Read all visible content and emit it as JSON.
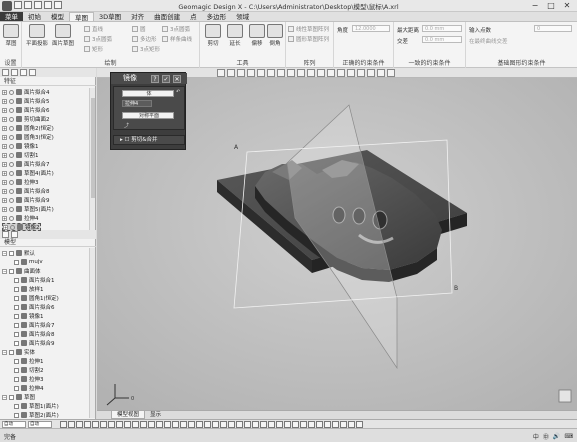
{
  "window": {
    "title": "Geomagic Design X - C:\\Users\\Administrator\\Desktop\\模型\\鼠标\\A.xrl",
    "minimize": "−",
    "maximize": "□",
    "close": "✕"
  },
  "menu": {
    "tabs": [
      {
        "label": "菜单"
      },
      {
        "label": "初始"
      },
      {
        "label": "模型"
      },
      {
        "label": "草图"
      },
      {
        "label": "3D草图"
      },
      {
        "label": "对齐"
      },
      {
        "label": "曲面创建"
      },
      {
        "label": "点"
      },
      {
        "label": "多边形"
      },
      {
        "label": "领域"
      }
    ]
  },
  "ribbon": {
    "groups": [
      {
        "label": "设置",
        "big": "草图"
      },
      {
        "label": "绘制"
      },
      {
        "label": "工具"
      },
      {
        "label": "阵列"
      },
      {
        "label": "正确的约束条件"
      },
      {
        "label": "一致的约束条件"
      },
      {
        "label": "基础图形约束条件"
      }
    ],
    "draw_items": [
      "直线",
      "3点圆弧",
      "矩形",
      "圆",
      "多边形",
      "3点圆弧",
      "3点矩形",
      "样条曲线"
    ],
    "draw_big": [
      "平面投影",
      "面片草图"
    ],
    "tool_items": [
      "剪切",
      "延长",
      "偏移",
      "倒角"
    ],
    "pattern_items": [
      "线性草图阵列",
      "圆形草图阵列"
    ],
    "constraints": {
      "angle_label": "角度",
      "angle_value": "12.0000",
      "max_offset_label": "最大距离",
      "max_offset_value": "0.0 mm",
      "cross_label": "交差",
      "cross_value": "0.0 mm",
      "input_label": "输入点数",
      "input_value": "0",
      "check_label": "在最终曲线交差"
    }
  },
  "left_panel": {
    "feature_title": "特征",
    "features": [
      {
        "label": "面片拟合4",
        "selected": false
      },
      {
        "label": "面片拟合5",
        "selected": false
      },
      {
        "label": "面片拟合6",
        "selected": false
      },
      {
        "label": "剪切曲面2",
        "selected": false
      },
      {
        "label": "圆角2(恒定)",
        "selected": false
      },
      {
        "label": "圆角3(恒定)",
        "selected": false
      },
      {
        "label": "镜像1",
        "selected": false
      },
      {
        "label": "切割1",
        "selected": false
      },
      {
        "label": "面片拟合7",
        "selected": false
      },
      {
        "label": "草图4(面片)",
        "selected": false
      },
      {
        "label": "拉伸3",
        "selected": false
      },
      {
        "label": "面片拟合8",
        "selected": false
      },
      {
        "label": "面片拟合9",
        "selected": false
      },
      {
        "label": "草图5(面片)",
        "selected": false
      },
      {
        "label": "拉伸4",
        "selected": false
      },
      {
        "label": "镜像2",
        "selected": true
      }
    ],
    "model_title": "模型",
    "model_tree": [
      {
        "label": "默认",
        "indent": 0,
        "kind": "group"
      },
      {
        "label": "mujv",
        "indent": 1,
        "kind": "item"
      },
      {
        "label": "曲面体",
        "indent": 0,
        "kind": "group"
      },
      {
        "label": "面片拟合1",
        "indent": 1,
        "kind": "item"
      },
      {
        "label": "放样1",
        "indent": 1,
        "kind": "item"
      },
      {
        "label": "圆角1(恒定)",
        "indent": 1,
        "kind": "item"
      },
      {
        "label": "面片拟合6",
        "indent": 1,
        "kind": "item"
      },
      {
        "label": "镜像1",
        "indent": 1,
        "kind": "item"
      },
      {
        "label": "面片拟合7",
        "indent": 1,
        "kind": "item"
      },
      {
        "label": "面片拟合8",
        "indent": 1,
        "kind": "item"
      },
      {
        "label": "面片拟合9",
        "indent": 1,
        "kind": "item"
      },
      {
        "label": "实体",
        "indent": 0,
        "kind": "group"
      },
      {
        "label": "拉伸1",
        "indent": 1,
        "kind": "item"
      },
      {
        "label": "切割2",
        "indent": 1,
        "kind": "item"
      },
      {
        "label": "拉伸3",
        "indent": 1,
        "kind": "item"
      },
      {
        "label": "拉伸4",
        "indent": 1,
        "kind": "item"
      },
      {
        "label": "草图",
        "indent": 0,
        "kind": "group"
      },
      {
        "label": "草图1(面片)",
        "indent": 1,
        "kind": "item"
      },
      {
        "label": "草图2(面片)",
        "indent": 1,
        "kind": "item"
      }
    ]
  },
  "dialog": {
    "title": "镜像",
    "ok": "✓",
    "cancel": "✕",
    "entity_label": "体",
    "entity_value": "拉伸4",
    "plane_label": "对称平面",
    "plane_value": "对称平面",
    "section_label": "剪切&合并"
  },
  "viewport": {
    "label_a": "A",
    "label_b": "B",
    "axis_label": "0"
  },
  "bottom_tabs": [
    {
      "label": "模型视图",
      "active": true
    },
    {
      "label": "显示",
      "active": false
    }
  ],
  "status": {
    "mode": "自动",
    "mode2": "自动",
    "taskbar_label": "完备",
    "tray": [
      "中",
      "㊥",
      "🔊",
      "⌨"
    ]
  },
  "colors": {
    "accent_active_tab": "#f4f4f4",
    "viewport_bg": "#c2c2c2",
    "dialog_bg": "#3d3d3d"
  }
}
